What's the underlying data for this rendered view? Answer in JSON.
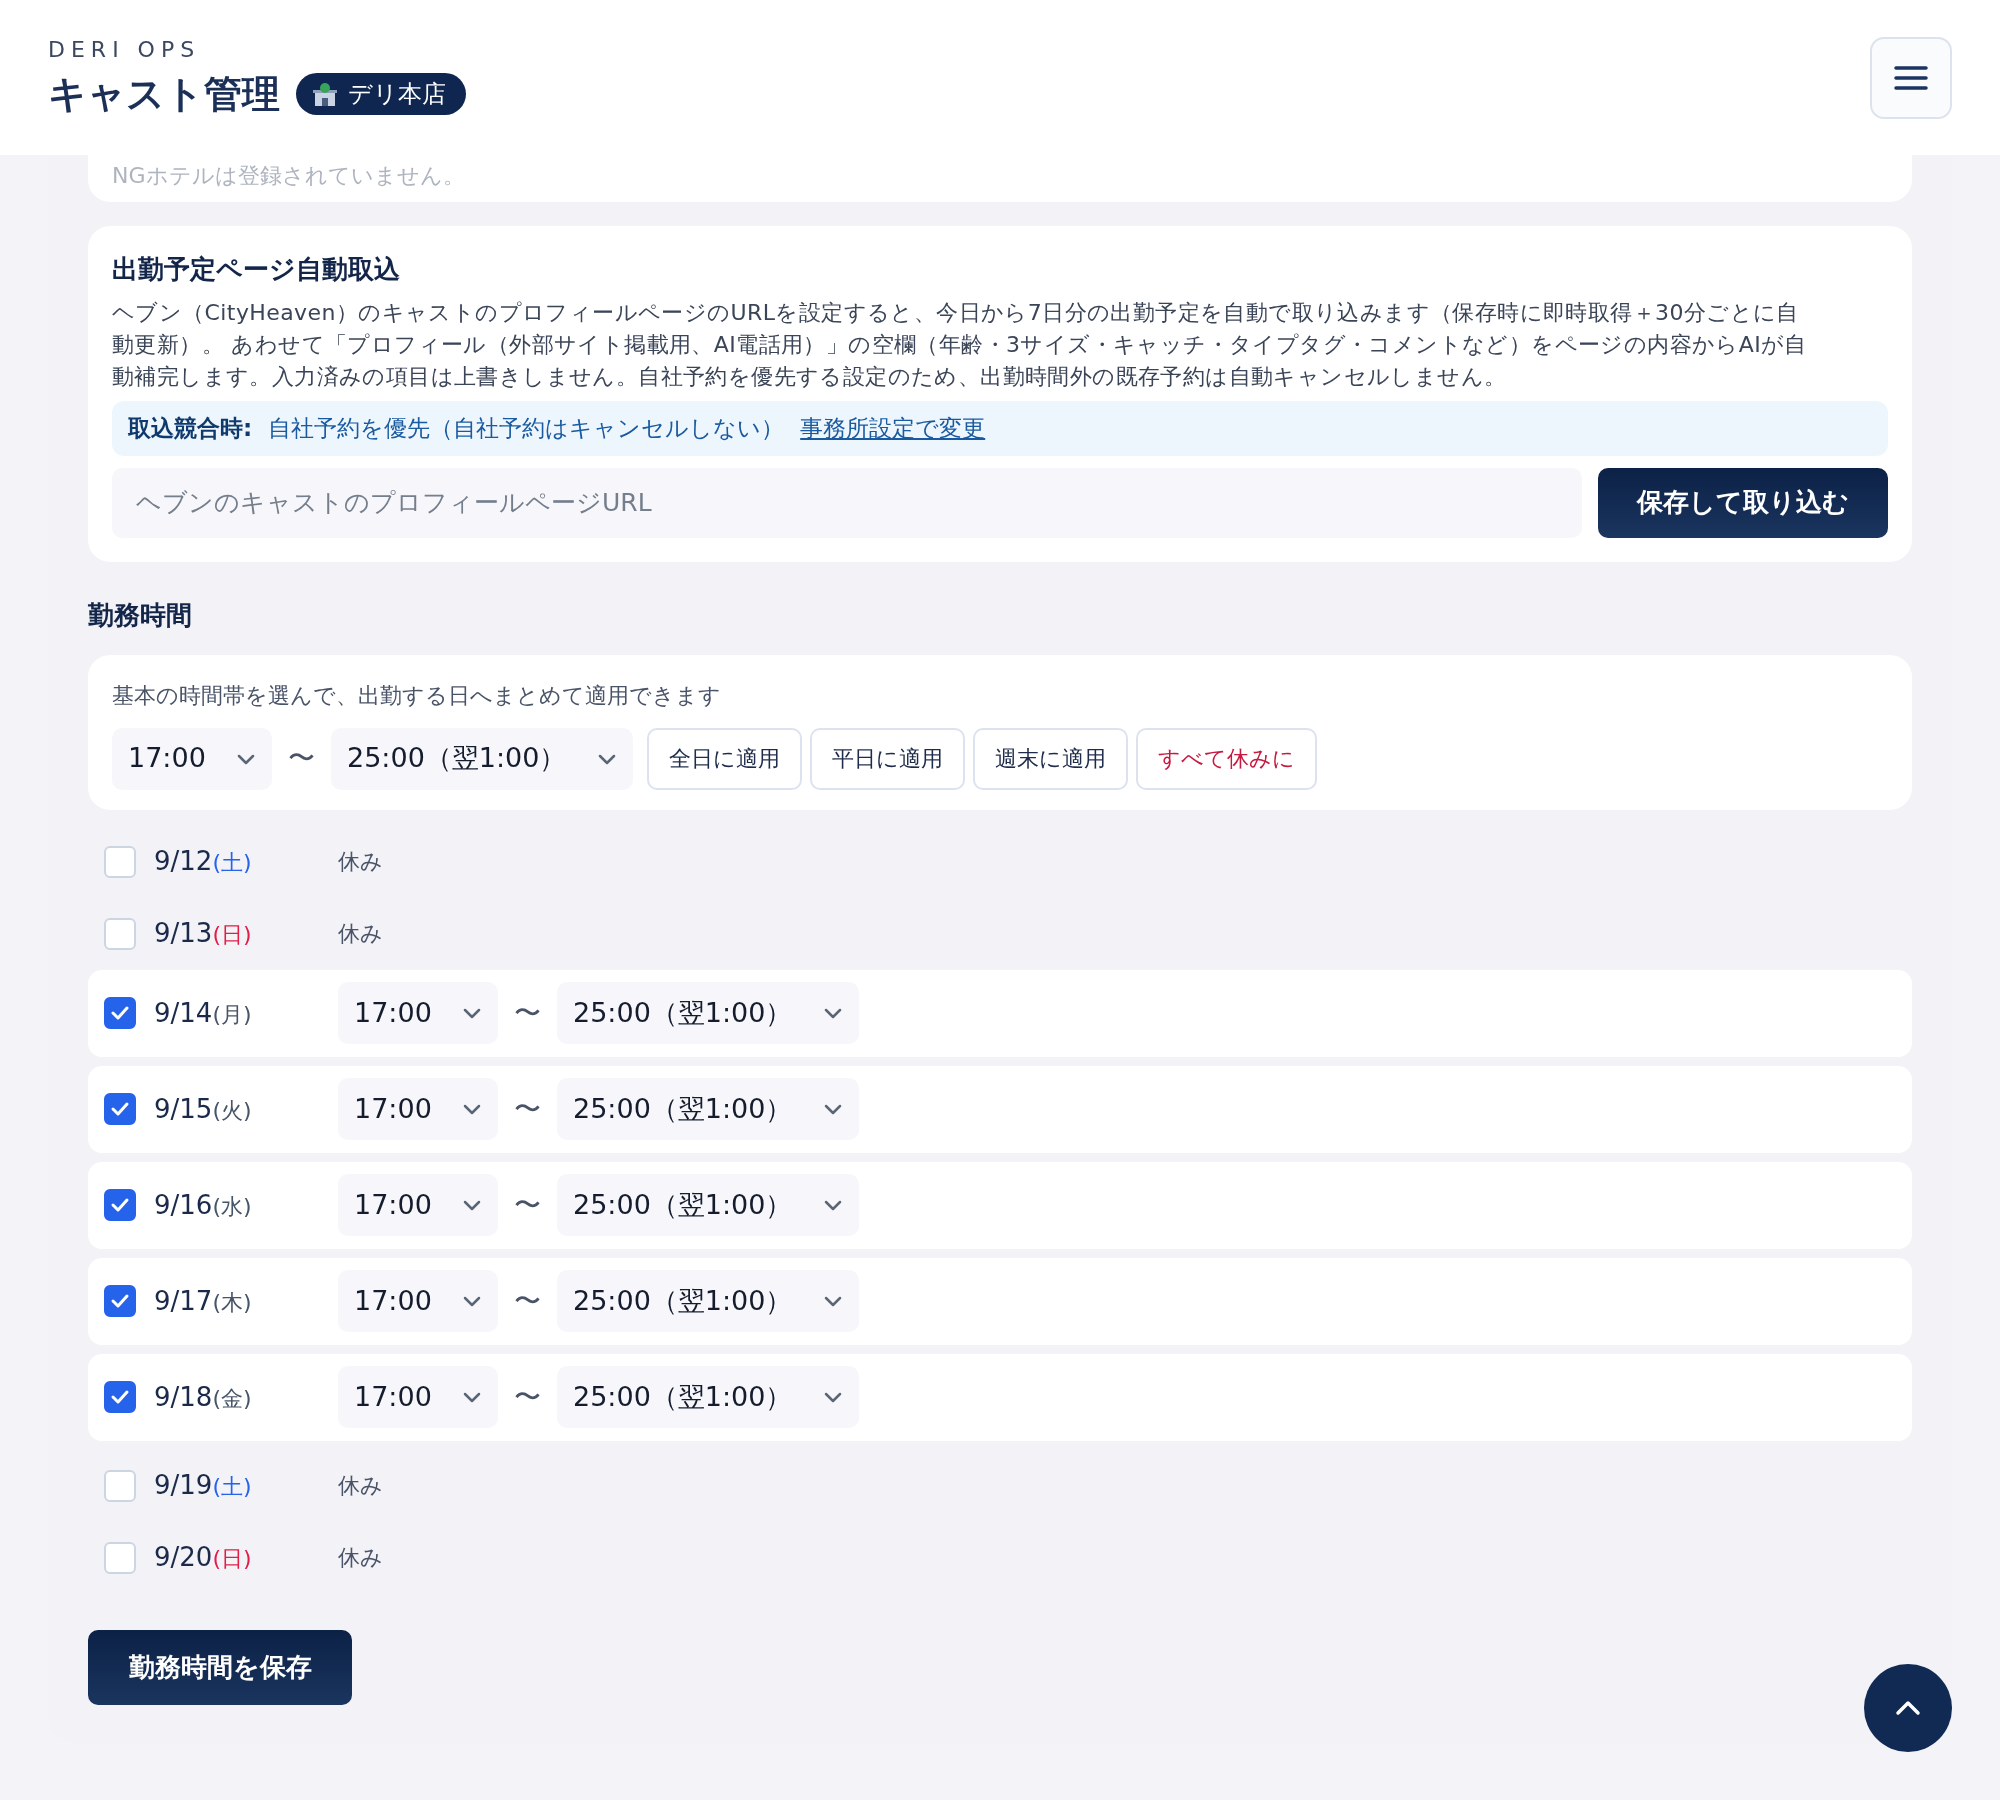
{
  "header": {
    "brand": "DERI OPS",
    "title": "キャスト管理",
    "store_badge": "デリ本店"
  },
  "ng_hotel_note": "NGホテルは登録されていません。",
  "import_card": {
    "title": "出勤予定ページ自動取込",
    "description": "ヘブン（CityHeaven）のキャストのプロフィールページのURLを設定すると、今日から7日分の出勤予定を自動で取り込みます（保存時に即時取得＋30分ごとに自動更新）。 あわせて「プロフィール（外部サイト掲載用、AI電話用）」の空欄（年齢・3サイズ・キャッチ・タイプタグ・コメントなど）をページの内容からAIが自動補完します。入力済みの項目は上書きしません。自社予約を優先する設定のため、出勤時間外の既存予約は自動キャンセルしません。",
    "conflict": {
      "label": "取込競合時:",
      "value": "自社予約を優先（自社予約はキャンセルしない）",
      "link": "事務所設定で変更"
    },
    "url_field": {
      "placeholder": "ヘブンのキャストのプロフィールページURL"
    },
    "button": "保存して取り込む"
  },
  "work_hours": {
    "heading": "勤務時間",
    "bulk": {
      "hint": "基本の時間帯を選んで、出勤する日へまとめて適用できます",
      "start": "17:00",
      "separator": "〜",
      "end": "25:00（翌1:00）",
      "buttons": [
        {
          "label": "全日に適用",
          "kind": "normal"
        },
        {
          "label": "平日に適用",
          "kind": "normal"
        },
        {
          "label": "週末に適用",
          "kind": "normal"
        },
        {
          "label": "すべて休みに",
          "kind": "danger"
        }
      ]
    },
    "days": [
      {
        "date": "9/12",
        "weekday": "(土)",
        "color": "#2563eb",
        "checked": false,
        "off_label": "休み"
      },
      {
        "date": "9/13",
        "weekday": "(日)",
        "color": "#e11d48",
        "checked": false,
        "off_label": "休み"
      },
      {
        "date": "9/14",
        "weekday": "(月)",
        "color": "#475569",
        "checked": true,
        "start": "17:00",
        "separator": "〜",
        "end": "25:00（翌1:00）"
      },
      {
        "date": "9/15",
        "weekday": "(火)",
        "color": "#475569",
        "checked": true,
        "start": "17:00",
        "separator": "〜",
        "end": "25:00（翌1:00）"
      },
      {
        "date": "9/16",
        "weekday": "(水)",
        "color": "#475569",
        "checked": true,
        "start": "17:00",
        "separator": "〜",
        "end": "25:00（翌1:00）"
      },
      {
        "date": "9/17",
        "weekday": "(木)",
        "color": "#475569",
        "checked": true,
        "start": "17:00",
        "separator": "〜",
        "end": "25:00（翌1:00）"
      },
      {
        "date": "9/18",
        "weekday": "(金)",
        "color": "#475569",
        "checked": true,
        "start": "17:00",
        "separator": "〜",
        "end": "25:00（翌1:00）"
      },
      {
        "date": "9/19",
        "weekday": "(土)",
        "color": "#2563eb",
        "checked": false,
        "off_label": "休み"
      },
      {
        "date": "9/20",
        "weekday": "(日)",
        "color": "#e11d48",
        "checked": false,
        "off_label": "休み"
      }
    ],
    "save_button": "勤務時間を保存"
  }
}
